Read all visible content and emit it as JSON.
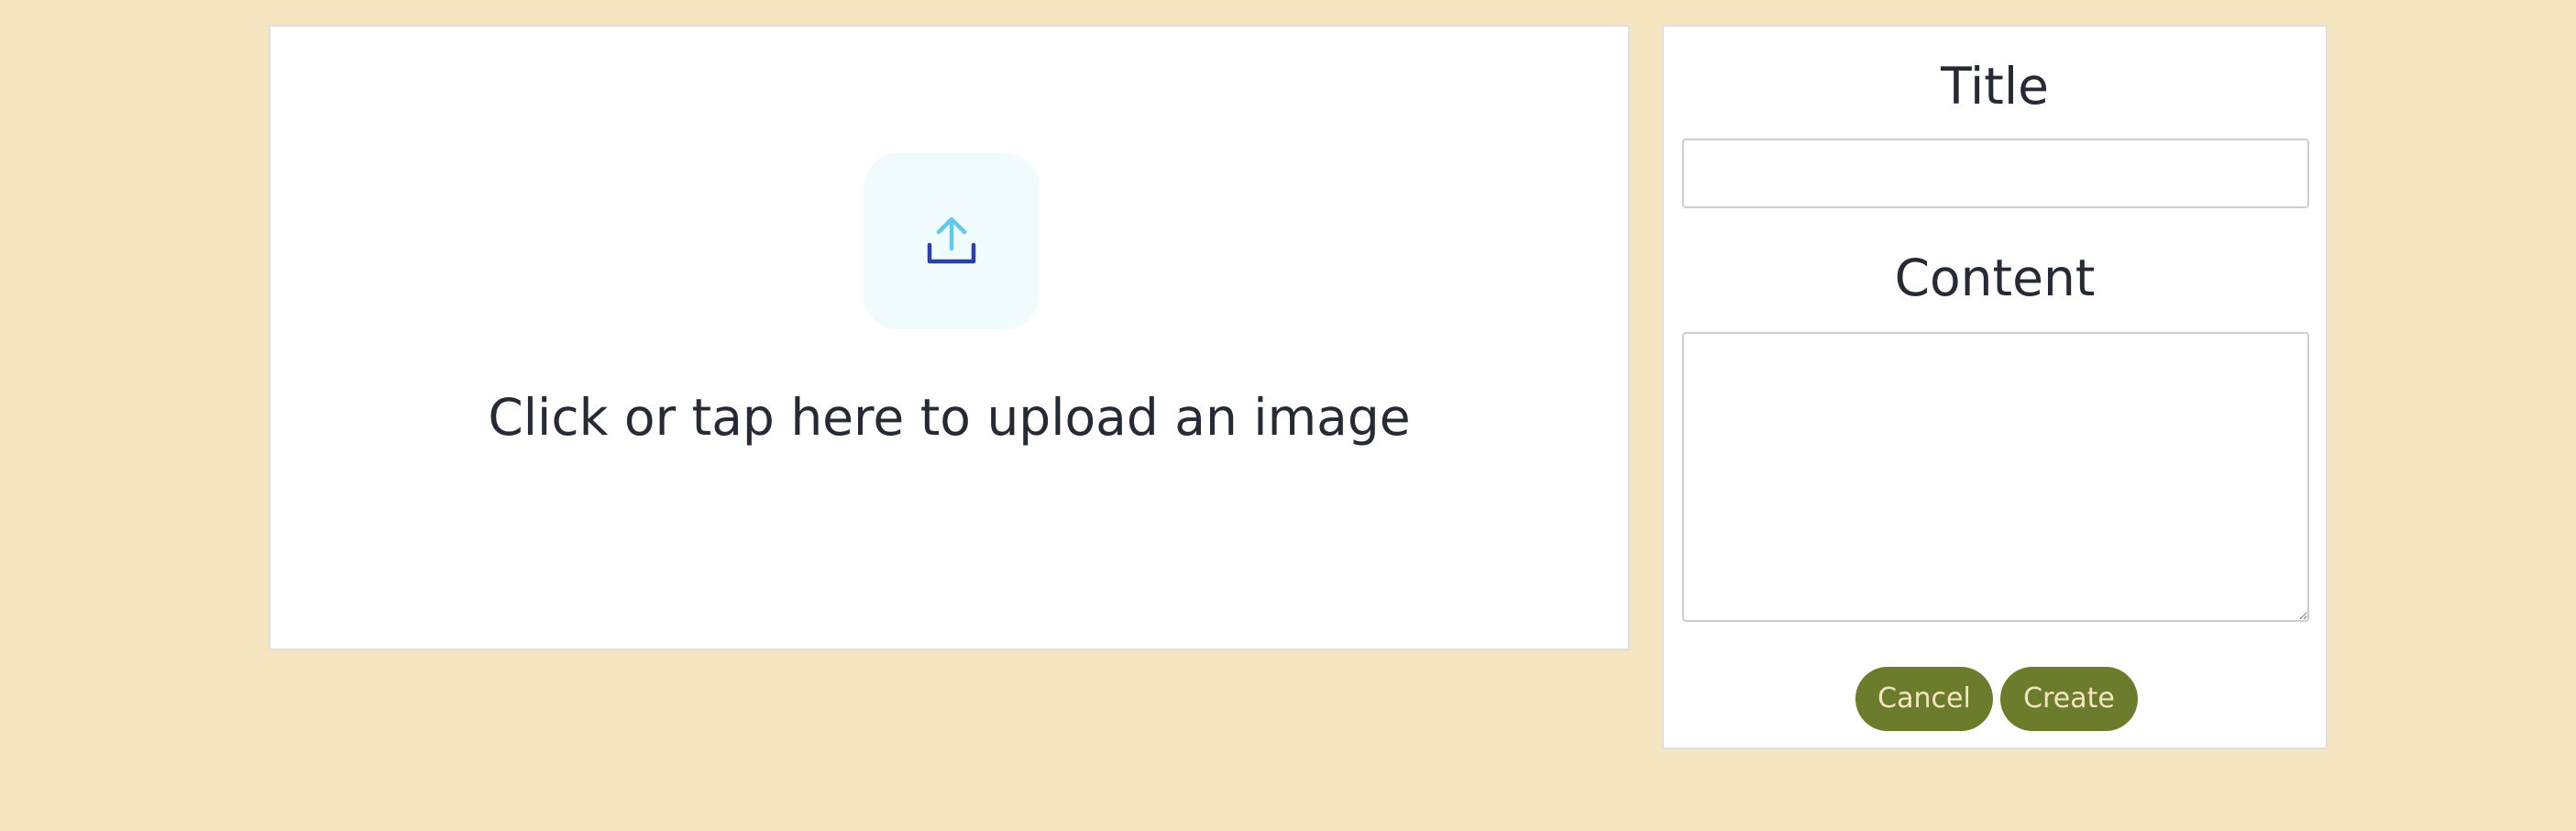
{
  "upload": {
    "prompt": "Click or tap here to upload an image",
    "icon": "upload-icon",
    "icon_colors": {
      "arrow": "#64c8ee",
      "tray": "#3040a0",
      "tile_background": "#effbfd"
    }
  },
  "form": {
    "title_label": "Title",
    "title_value": "",
    "content_label": "Content",
    "content_value": "",
    "cancel_label": "Cancel",
    "create_label": "Create"
  },
  "colors": {
    "page_background": "#f5e6c1",
    "panel_background": "#ffffff",
    "button_background": "#6b7c2c",
    "button_text": "#f5e6c1",
    "text": "#252a34"
  }
}
